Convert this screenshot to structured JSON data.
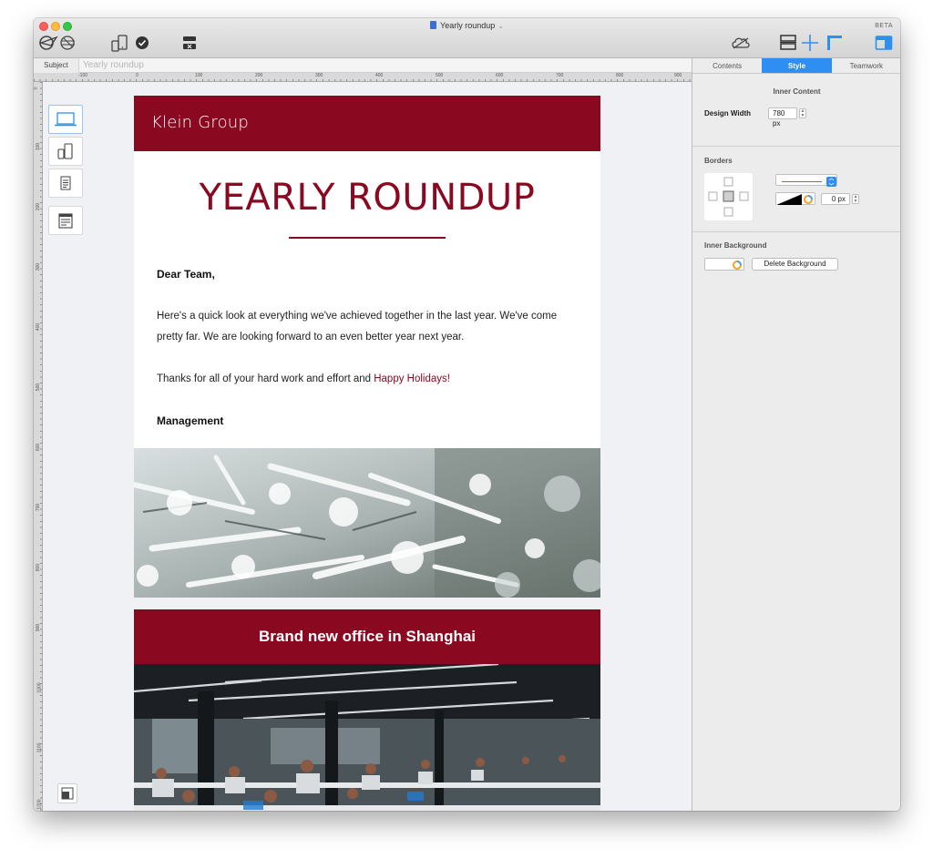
{
  "window": {
    "title": "Yearly roundup",
    "badge": "BETA"
  },
  "toolbar": {
    "left_icons": [
      "preview-send-icon",
      "devices-preview-icon",
      "check-icon",
      "delete-block-icon"
    ],
    "right_icons": [
      "cloud-icon",
      "layout-icon",
      "guides-icon",
      "ruler-icon",
      "sidebar-toggle-icon"
    ]
  },
  "subject": {
    "label": "Subject",
    "value": "Yearly roundup"
  },
  "ruler": {
    "top_labels": [
      "-100",
      "0",
      "100",
      "200",
      "300",
      "400",
      "500",
      "600",
      "700",
      "800",
      "900"
    ],
    "left_labels": [
      "0",
      "100",
      "200",
      "300",
      "400",
      "500",
      "600",
      "700",
      "800",
      "900",
      "1000",
      "1100",
      "1200"
    ]
  },
  "devices": [
    "desktop-icon",
    "mobile-tablet-icon",
    "text-only-icon",
    "email-client-icon"
  ],
  "email": {
    "brand": "Klein Group",
    "headline": "YEARLY ROUNDUP",
    "greeting": "Dear Team,",
    "paragraph1": "Here's a quick look at everything we've achieved together in the last year. We've come pretty far. We are looking forward to an even better year next year.",
    "paragraph2_prefix": "Thanks for all of your hard work and effort and ",
    "paragraph2_link": "Happy Holidays!",
    "signoff": "Management",
    "section_title": "Brand new office in Shanghai",
    "colors": {
      "accent": "#8a0820",
      "text": "#222222"
    }
  },
  "panel": {
    "tabs": [
      {
        "label": "Contents",
        "active": false
      },
      {
        "label": "Style",
        "active": true
      },
      {
        "label": "Teamwork",
        "active": false
      }
    ],
    "inner_content_title": "Inner Content",
    "design_width_label": "Design Width",
    "design_width_value": "780 px",
    "borders_title": "Borders",
    "border_width_value": "0 px",
    "inner_background_title": "Inner Background",
    "delete_background_label": "Delete Background",
    "accent": "#2f8ef2"
  }
}
